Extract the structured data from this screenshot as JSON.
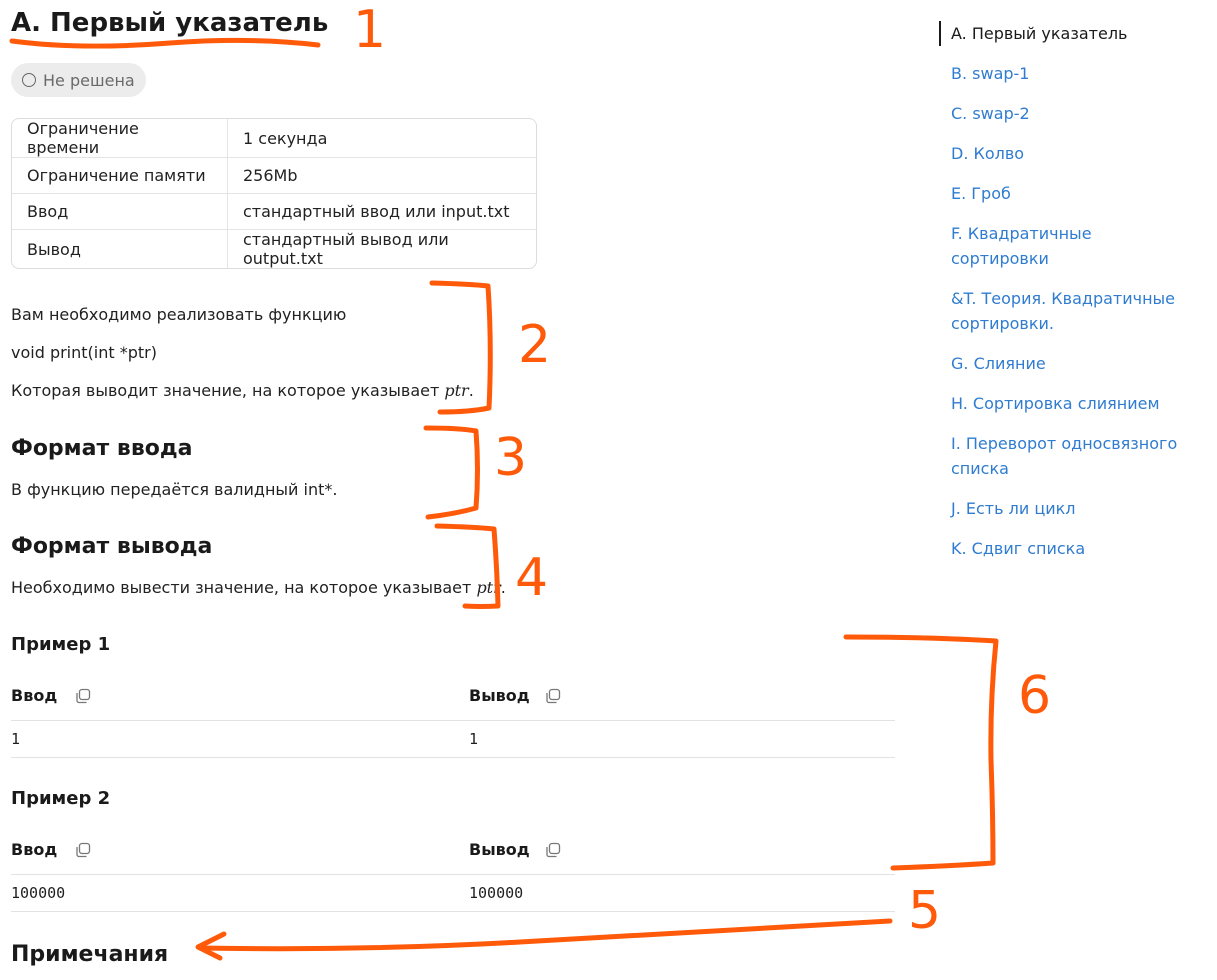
{
  "problem": {
    "title": "А. Первый указатель",
    "status": "Не решена",
    "limits": [
      {
        "label": "Ограничение времени",
        "value": "1 секунда"
      },
      {
        "label": "Ограничение памяти",
        "value": "256Mb"
      },
      {
        "label": "Ввод",
        "value": "стандартный ввод или input.txt"
      },
      {
        "label": "Вывод",
        "value": "стандартный вывод или output.txt"
      }
    ],
    "statement": {
      "line1": "Вам необходимо реализовать функцию",
      "line2": "void print(int *ptr)",
      "line3": "Которая выводит значение, на которое указывает ",
      "var": "ptr"
    },
    "input_format": {
      "heading": "Формат ввода",
      "text": "В функцию передаётся валидный int*."
    },
    "output_format": {
      "heading": "Формат вывода",
      "text": "Необходимо вывести значение, на которое указывает ",
      "var": "ptr"
    },
    "examples": [
      {
        "heading": "Пример 1",
        "input_label": "Ввод",
        "output_label": "Вывод",
        "input": "1",
        "output": "1"
      },
      {
        "heading": "Пример 2",
        "input_label": "Ввод",
        "output_label": "Вывод",
        "input": "100000",
        "output": "100000"
      }
    ],
    "notes_heading": "Примечания"
  },
  "sidebar": {
    "items": [
      {
        "label": "A. Первый указатель",
        "active": true
      },
      {
        "label": "B. swap-1"
      },
      {
        "label": "C. swap-2"
      },
      {
        "label": "D. Колво"
      },
      {
        "label": "E. Гроб"
      },
      {
        "label": "F. Квадратичные сортировки"
      },
      {
        "label": "&T. Теория. Квадратичные сортировки."
      },
      {
        "label": "G. Слияние"
      },
      {
        "label": "H. Сортировка слиянием"
      },
      {
        "label": "I. Переворот односвязного списка"
      },
      {
        "label": "J. Есть ли цикл"
      },
      {
        "label": "K. Сдвиг списка"
      }
    ]
  },
  "annotations": {
    "color": "#ff5a0a",
    "labels": [
      "1",
      "2",
      "3",
      "4",
      "6",
      "5"
    ]
  },
  "colors": {
    "link": "#2f7cd0",
    "text": "#1f1f1f",
    "status_bg": "#ececec"
  }
}
